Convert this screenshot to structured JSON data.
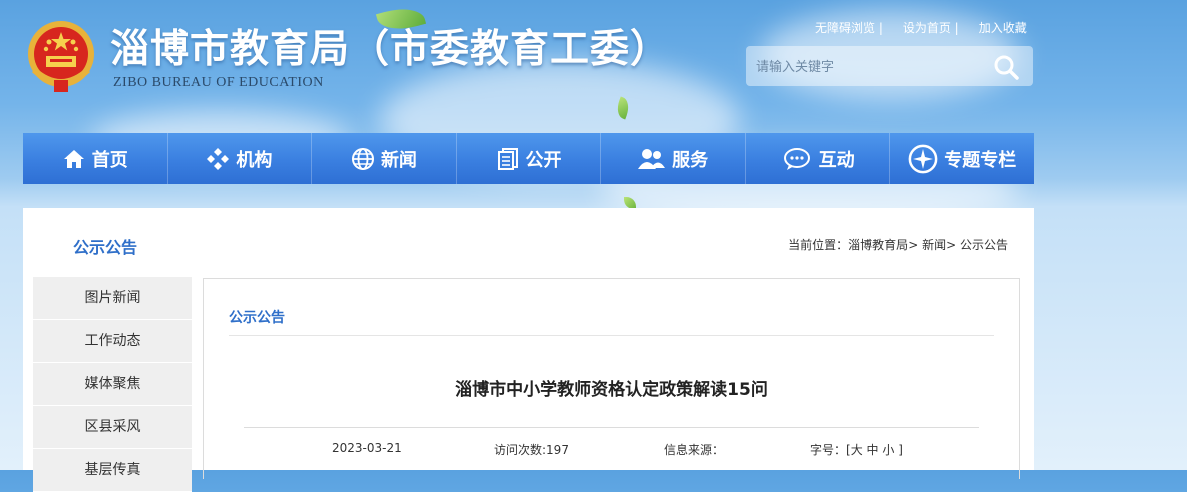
{
  "header": {
    "title": "淄博市教育局（市委教育工委）",
    "subtitle": "ZIBO BUREAU OF EDUCATION",
    "links": [
      "无障碍浏览 |",
      "设为首页 |",
      "加入收藏"
    ],
    "search_placeholder": "请输入关键字"
  },
  "nav": [
    {
      "label": "首页",
      "icon": "home-icon"
    },
    {
      "label": "机构",
      "icon": "org-icon"
    },
    {
      "label": "新闻",
      "icon": "globe-icon"
    },
    {
      "label": "公开",
      "icon": "document-icon"
    },
    {
      "label": "服务",
      "icon": "people-icon"
    },
    {
      "label": "互动",
      "icon": "chat-icon"
    },
    {
      "label": "专题专栏",
      "icon": "compass-icon"
    }
  ],
  "section_title": "公示公告",
  "breadcrumb": {
    "prefix": "当前位置：",
    "items": [
      "淄博教育局",
      "新闻",
      "公示公告"
    ],
    "sep": ">"
  },
  "sidebar": [
    "图片新闻",
    "工作动态",
    "媒体聚焦",
    "区县采风",
    "基层传真"
  ],
  "article": {
    "category": "公示公告",
    "title": "淄博市中小学教师资格认定政策解读15问",
    "date": "2023-03-21",
    "views": "访问次数:197",
    "source": "信息来源：",
    "fontsize_label": "字号：[",
    "fs_large": "大",
    "fs_medium": "中",
    "fs_small": "小",
    "fontsize_end": "]"
  },
  "colors": {
    "nav_blue": "#3a7fe0",
    "title_blue": "#2f6fc9",
    "sidebar_bg": "#efefef"
  }
}
